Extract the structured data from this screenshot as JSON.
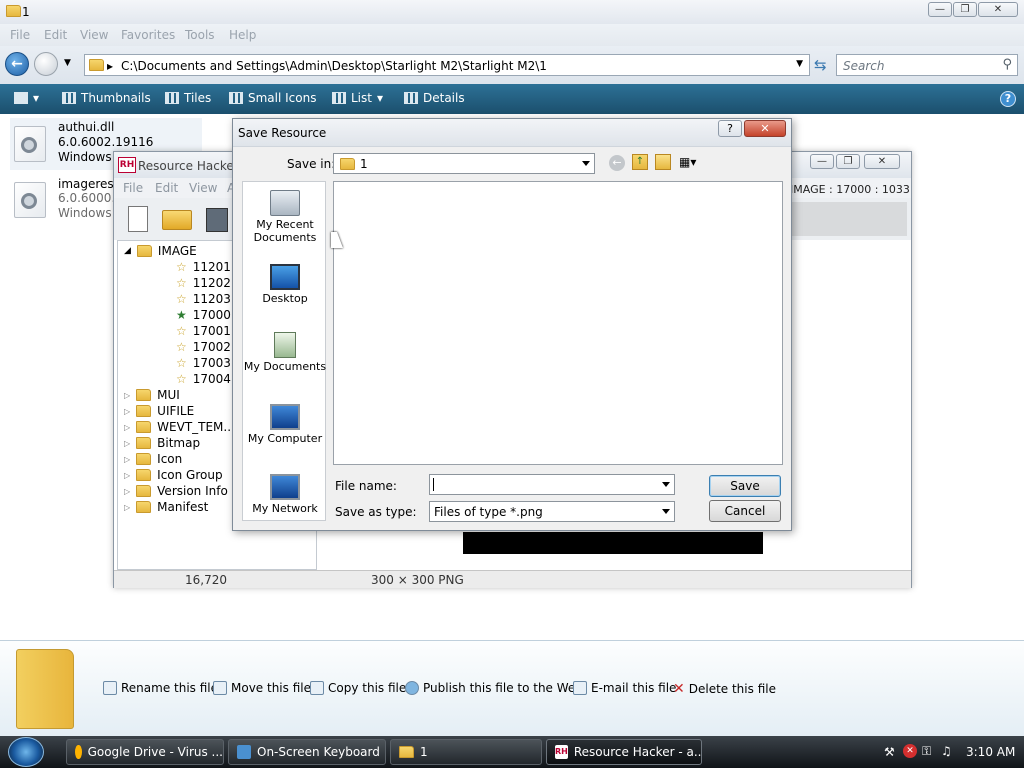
{
  "explorer": {
    "title": "1",
    "menu": [
      "File",
      "Edit",
      "View",
      "Favorites",
      "Tools",
      "Help"
    ],
    "address": "C:\\Documents and Settings\\Admin\\Desktop\\Starlight M2\\Starlight M2\\1",
    "search_placeholder": "Search",
    "toolbar": {
      "thumbnails": "Thumbnails",
      "tiles": "Tiles",
      "small_icons": "Small Icons",
      "list": "List",
      "details": "Details"
    },
    "files": [
      {
        "name": "authui.dll",
        "version": "6.0.6002.19116",
        "desc": "Windows ..."
      },
      {
        "name": "imageres.d...",
        "version": "6.0.6000.16...",
        "desc": "Windows I..."
      }
    ]
  },
  "resource_hacker": {
    "title": "Resource Hacker - ...",
    "menu": [
      "File",
      "Edit",
      "View",
      "A..."
    ],
    "info": "IMAGE : 17000 : 1033",
    "tree": {
      "root": "IMAGE",
      "image_children": [
        "11201",
        "11202",
        "11203",
        "17000",
        "17001",
        "17002",
        "17003",
        "17004"
      ],
      "folders": [
        "MUI",
        "UIFILE",
        "WEVT_TEM...",
        "Bitmap",
        "Icon",
        "Icon Group",
        "Version Info",
        "Manifest"
      ]
    },
    "status": {
      "size": "16,720",
      "image": "300 × 300  PNG"
    }
  },
  "save_dialog": {
    "title": "Save Resource",
    "save_in_label": "Save in:",
    "save_in_value": "1",
    "places": [
      "My Recent Documents",
      "Desktop",
      "My Documents",
      "My Computer",
      "My Network"
    ],
    "file_name_label": "File name:",
    "file_name_value": "",
    "save_as_type_label": "Save as type:",
    "save_as_type_value": "Files of type *.png",
    "save_button": "Save",
    "cancel_button": "Cancel",
    "help_button": "?",
    "close_button": "✕"
  },
  "details_pane": {
    "actions": [
      "Rename this file",
      "Move this file",
      "Copy this file",
      "Publish this file to the Web",
      "E-mail this file",
      "Delete this file"
    ]
  },
  "taskbar": {
    "tasks": [
      "Google Drive - Virus ...",
      "On-Screen Keyboard",
      "1",
      "Resource Hacker - a..."
    ],
    "clock": "3:10 AM"
  }
}
